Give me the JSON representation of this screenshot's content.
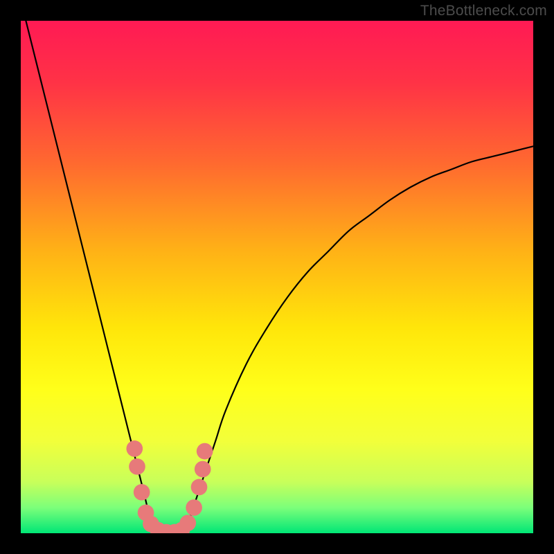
{
  "watermark": {
    "text": "TheBottleneck.com"
  },
  "chart_data": {
    "type": "line",
    "title": "",
    "xlabel": "",
    "ylabel": "",
    "xlim": [
      0,
      100
    ],
    "ylim": [
      0,
      100
    ],
    "gradient_stops": [
      {
        "offset": 0.0,
        "color": "#ff1a54"
      },
      {
        "offset": 0.12,
        "color": "#ff3246"
      },
      {
        "offset": 0.28,
        "color": "#ff6a2f"
      },
      {
        "offset": 0.45,
        "color": "#ffb216"
      },
      {
        "offset": 0.6,
        "color": "#ffe60a"
      },
      {
        "offset": 0.72,
        "color": "#ffff1a"
      },
      {
        "offset": 0.82,
        "color": "#f2ff3a"
      },
      {
        "offset": 0.9,
        "color": "#c8ff5a"
      },
      {
        "offset": 0.95,
        "color": "#7cff7a"
      },
      {
        "offset": 1.0,
        "color": "#00e676"
      }
    ],
    "series": [
      {
        "name": "bottleneck-curve",
        "x": [
          0,
          2,
          4,
          6,
          8,
          10,
          12,
          14,
          16,
          18,
          20,
          22,
          24,
          25,
          26,
          27,
          28,
          29,
          30,
          31,
          32,
          33,
          34,
          36,
          38,
          40,
          44,
          48,
          52,
          56,
          60,
          64,
          68,
          72,
          76,
          80,
          84,
          88,
          92,
          96,
          100
        ],
        "y": [
          104,
          96,
          88,
          80,
          72,
          64,
          56,
          48,
          40,
          32,
          24,
          16,
          8,
          4,
          2,
          0,
          0,
          0,
          0,
          0,
          1,
          3,
          6,
          12,
          18,
          24,
          33,
          40,
          46,
          51,
          55,
          59,
          62,
          65,
          67.5,
          69.5,
          71,
          72.5,
          73.5,
          74.5,
          75.5
        ]
      }
    ],
    "highlight_points": {
      "name": "highlighted-range",
      "color": "#e77a7a",
      "radius_pct": 1.6,
      "points": [
        {
          "x": 22.2,
          "y": 16.5
        },
        {
          "x": 22.7,
          "y": 13.0
        },
        {
          "x": 23.6,
          "y": 8.0
        },
        {
          "x": 24.4,
          "y": 4.0
        },
        {
          "x": 25.4,
          "y": 1.8
        },
        {
          "x": 26.8,
          "y": 0.6
        },
        {
          "x": 28.4,
          "y": 0.2
        },
        {
          "x": 30.0,
          "y": 0.2
        },
        {
          "x": 31.4,
          "y": 0.6
        },
        {
          "x": 32.6,
          "y": 2.0
        },
        {
          "x": 33.8,
          "y": 5.0
        },
        {
          "x": 34.8,
          "y": 9.0
        },
        {
          "x": 35.5,
          "y": 12.5
        },
        {
          "x": 35.9,
          "y": 16.0
        }
      ]
    }
  }
}
